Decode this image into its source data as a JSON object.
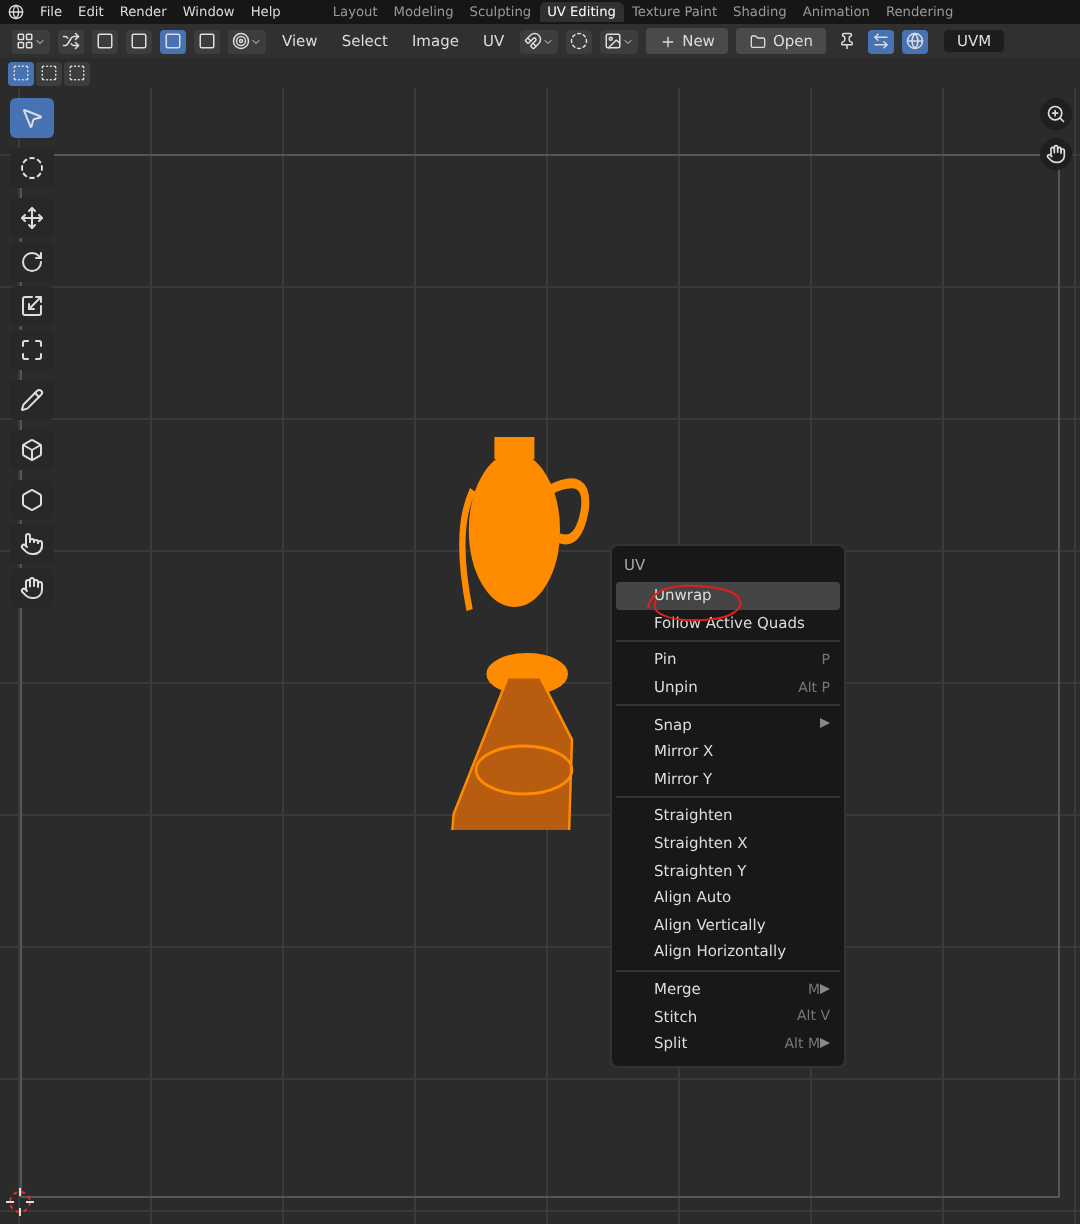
{
  "top_menu": [
    "File",
    "Edit",
    "Render",
    "Window",
    "Help"
  ],
  "workspaces": [
    {
      "label": "Layout",
      "selected": false
    },
    {
      "label": "Modeling",
      "selected": false
    },
    {
      "label": "Sculpting",
      "selected": false
    },
    {
      "label": "UV Editing",
      "selected": true
    },
    {
      "label": "Texture Paint",
      "selected": false
    },
    {
      "label": "Shading",
      "selected": false
    },
    {
      "label": "Animation",
      "selected": false
    },
    {
      "label": "Rendering",
      "selected": false
    }
  ],
  "header": {
    "select_modes": [
      {
        "selected": false
      },
      {
        "selected": false
      },
      {
        "selected": true
      },
      {
        "selected": false
      }
    ],
    "menus": [
      "View",
      "Select",
      "Image",
      "UV"
    ],
    "new_button": "New",
    "open_button": "Open",
    "uv_map": "UVM"
  },
  "selection_modes": [
    {
      "selected": true
    },
    {
      "selected": false
    },
    {
      "selected": false
    }
  ],
  "tools": [
    {
      "selected": true
    },
    {
      "selected": false
    },
    {
      "selected": false
    },
    {
      "selected": false
    },
    {
      "selected": false
    },
    {
      "selected": false
    },
    {
      "selected": false
    },
    {
      "selected": false
    },
    {
      "selected": false
    },
    {
      "selected": false
    },
    {
      "selected": false
    }
  ],
  "context_menu": {
    "title": "UV",
    "groups": [
      [
        {
          "label": "Unwrap",
          "submenu": false,
          "selected": true
        },
        {
          "label": "Follow Active Quads",
          "submenu": false,
          "selected": false
        }
      ],
      [
        {
          "label": "Pin",
          "shortcut": "P",
          "submenu": false,
          "selected": false
        },
        {
          "label": "Unpin",
          "shortcut": "Alt P",
          "submenu": false,
          "selected": false
        }
      ],
      [
        {
          "label": "Snap",
          "submenu": true,
          "selected": false
        },
        {
          "label": "Mirror X",
          "submenu": false,
          "selected": false
        },
        {
          "label": "Mirror Y",
          "submenu": false,
          "selected": false
        }
      ],
      [
        {
          "label": "Straighten",
          "submenu": false,
          "selected": false
        },
        {
          "label": "Straighten X",
          "submenu": false,
          "selected": false
        },
        {
          "label": "Straighten Y",
          "submenu": false,
          "selected": false
        },
        {
          "label": "Align Auto",
          "submenu": false,
          "selected": false
        },
        {
          "label": "Align Vertically",
          "submenu": false,
          "selected": false
        },
        {
          "label": "Align Horizontally",
          "submenu": false,
          "selected": false
        }
      ],
      [
        {
          "label": "Merge",
          "shortcut": "M",
          "submenu": true,
          "selected": false
        },
        {
          "label": "Stitch",
          "shortcut": "Alt V",
          "submenu": false,
          "selected": false
        },
        {
          "label": "Split",
          "shortcut": "Alt M",
          "submenu": true,
          "selected": false
        }
      ]
    ]
  }
}
